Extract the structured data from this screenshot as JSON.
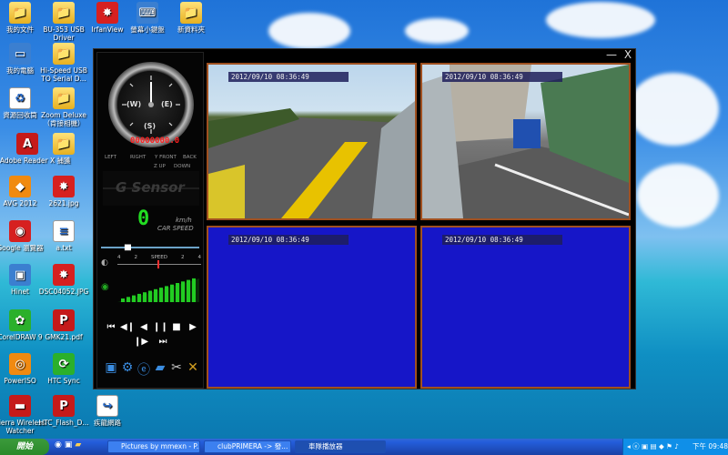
{
  "desktop": {
    "icons": [
      {
        "label": "我的文件"
      },
      {
        "label": "我的電腦"
      },
      {
        "label": "資源回收筒"
      },
      {
        "label": "Adobe Reader X"
      },
      {
        "label": "AVG 2012"
      },
      {
        "label": "Google 瀏覽器"
      },
      {
        "label": "Hinet"
      },
      {
        "label": "CorelDRAW 9"
      },
      {
        "label": "PowerISO"
      },
      {
        "label": "Sierra Wireless Watcher"
      },
      {
        "label": "BU-353 USB Driver"
      },
      {
        "label": "Hi-Speed USB TO Serial D..."
      },
      {
        "label": "Zoom Deluxe（肯接相機）"
      },
      {
        "label": "捕獲"
      },
      {
        "label": "2621.jpg"
      },
      {
        "label": "a.txt"
      },
      {
        "label": "DSC04052.JPG"
      },
      {
        "label": "GMK21.pdf"
      },
      {
        "label": "HTC Sync"
      },
      {
        "label": "HTC_Flash_D..."
      },
      {
        "label": "IrfanView"
      },
      {
        "label": "螢幕小鍵盤"
      },
      {
        "label": "新資料夾"
      },
      {
        "label": "疾龍網路"
      }
    ]
  },
  "player": {
    "close_label": "X",
    "minimize_label": "—",
    "gauge": {
      "label_w": "(W)",
      "label_e": "(E)",
      "label_s": "(S)"
    },
    "odometer": "00000000.0",
    "indicators": {
      "left": "LEFT",
      "right": "RIGHT",
      "front": "Y FRONT",
      "back": "BACK",
      "up": "Z UP",
      "down": "DOWN"
    },
    "gsensor_label": "G Sensor",
    "speed": {
      "value": "0",
      "unit": "km/h",
      "label": "CAR SPEED"
    },
    "speed_scale": {
      "ticks": [
        "4",
        "2",
        "SPEED",
        "2",
        "4"
      ]
    },
    "playback_row1": [
      "⏮",
      "◀❙",
      "◀",
      "❙❙",
      "■",
      "▶"
    ],
    "playback_row2": [
      "❙▶",
      "⏭"
    ],
    "cameras": [
      {
        "timestamp": "2012/09/10 08:36:49"
      },
      {
        "timestamp": "2012/09/10 08:36:49"
      },
      {
        "timestamp": "2012/09/10 08:36:49"
      },
      {
        "timestamp": "2012/09/10 08:36:49"
      }
    ]
  },
  "taskbar": {
    "start_label": "開始",
    "tasks": [
      {
        "label": "Pictures by mmexn - P..."
      },
      {
        "label": "clubPRIMERA -> 發..."
      },
      {
        "label": "車隊播放器"
      }
    ],
    "clock": "下午 09:48"
  },
  "colors": {
    "cam_border": "#a05020",
    "cam_blue": "#1616c8",
    "speed_green": "#22dd22",
    "led_red": "#ff2020"
  }
}
